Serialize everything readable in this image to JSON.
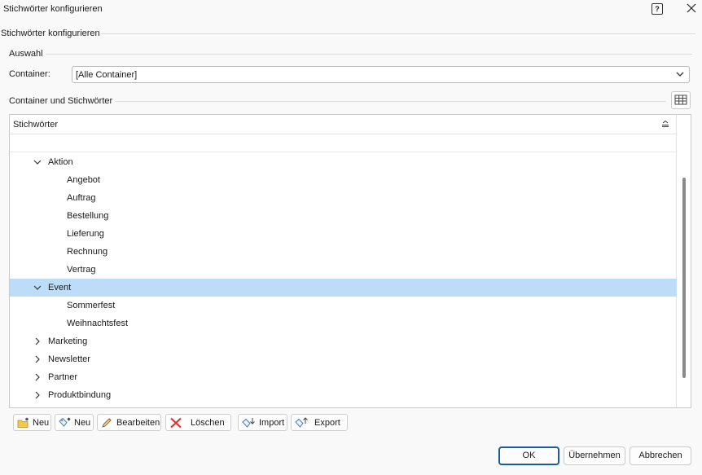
{
  "window": {
    "title": "Stichwörter konfigurieren"
  },
  "group_title": "Stichwörter konfigurieren",
  "selection": {
    "title": "Auswahl",
    "container_label": "Container:",
    "container_value": "[Alle Container]"
  },
  "tree_section": {
    "title": "Container und Stichwörter",
    "column_header": "Stichwörter",
    "selected_row": "Event",
    "rows": [
      {
        "label": "Aktion",
        "level": 0,
        "expanded": true
      },
      {
        "label": "Angebot",
        "level": 1
      },
      {
        "label": "Auftrag",
        "level": 1
      },
      {
        "label": "Bestellung",
        "level": 1
      },
      {
        "label": "Lieferung",
        "level": 1
      },
      {
        "label": "Rechnung",
        "level": 1
      },
      {
        "label": "Vertrag",
        "level": 1
      },
      {
        "label": "Event",
        "level": 0,
        "expanded": true
      },
      {
        "label": "Sommerfest",
        "level": 1
      },
      {
        "label": "Weihnachtsfest",
        "level": 1
      },
      {
        "label": "Marketing",
        "level": 0,
        "expanded": false
      },
      {
        "label": "Newsletter",
        "level": 0,
        "expanded": false
      },
      {
        "label": "Partner",
        "level": 0,
        "expanded": false
      },
      {
        "label": "Produktbindung",
        "level": 0,
        "expanded": false
      }
    ]
  },
  "toolbar": {
    "new_container": "Neu",
    "new_keyword": "Neu",
    "edit": "Bearbeiten",
    "delete": "Löschen",
    "import": "Import",
    "export": "Export"
  },
  "dialog_buttons": {
    "ok": "OK",
    "apply": "Übernehmen",
    "cancel": "Abbrechen"
  },
  "colors": {
    "selection": "#bcdcf8",
    "primary_border": "#1b5aa0",
    "delete_icon": "#d9362b"
  }
}
